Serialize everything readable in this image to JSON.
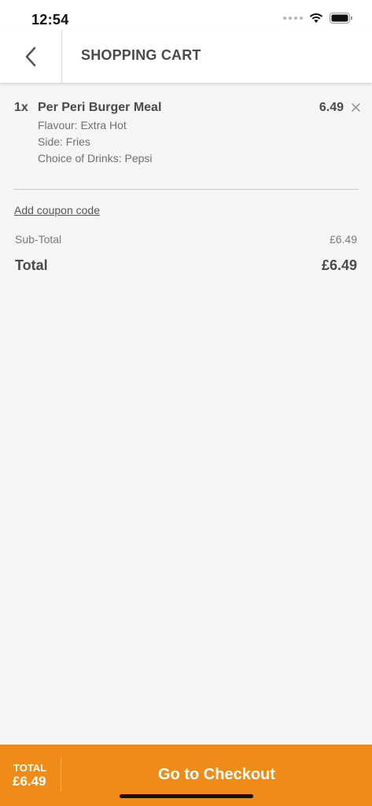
{
  "status_bar": {
    "time": "12:54"
  },
  "header": {
    "title": "SHOPPING CART"
  },
  "cart": {
    "items": [
      {
        "qty": "1x",
        "name": "Per Peri Burger Meal",
        "price": "6.49",
        "options": [
          "Flavour: Extra Hot",
          "Side: Fries",
          "Choice of Drinks: Pepsi"
        ]
      }
    ]
  },
  "coupon": {
    "label": "Add coupon code"
  },
  "summary": {
    "subtotal_label": "Sub-Total",
    "subtotal_value": "£6.49",
    "total_label": "Total",
    "total_value": "£6.49"
  },
  "checkout_bar": {
    "total_label": "TOTAL",
    "total_value": "£6.49",
    "button_label": "Go to Checkout"
  },
  "colors": {
    "accent": "#ef8b18",
    "background": "#f5f5f5"
  },
  "icons": {
    "back": "chevron-left-icon",
    "remove": "close-icon",
    "wifi": "wifi-icon",
    "battery": "battery-icon",
    "signal": "signal-icon"
  }
}
